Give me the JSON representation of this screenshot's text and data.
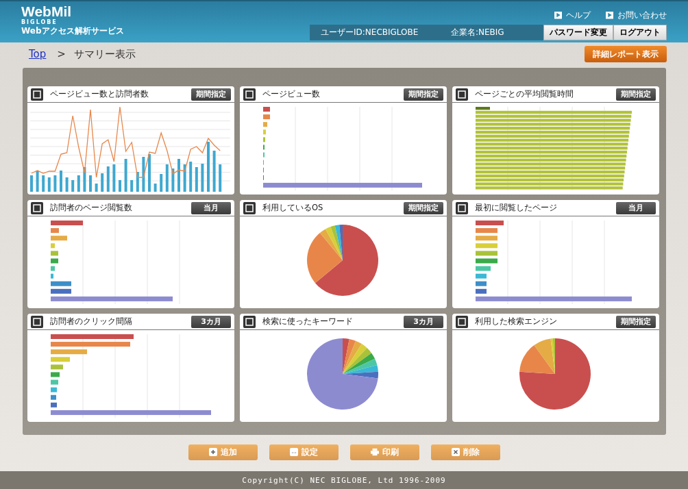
{
  "header": {
    "logo": "WebMil",
    "logo_sub1": "BIGLOBE",
    "logo_sub2": "Webアクセス解析サービス",
    "links": [
      "ヘルプ",
      "お問い合わせ"
    ],
    "user_id": "ユーザーID:NECBIGLOBE",
    "company": "企業名:NEBIG",
    "buttons": [
      "パスワード変更",
      "ログアウト"
    ]
  },
  "breadcrumb": {
    "link": "Top",
    "separator": ">",
    "current": "サマリー表示"
  },
  "report_button": "詳細レポート表示",
  "panels": [
    {
      "title": "ページビュー数と訪問者数",
      "period": "期間指定",
      "kind": "line-bar"
    },
    {
      "title": "ページビュー数",
      "period": "期間指定",
      "kind": "bar"
    },
    {
      "title": "ページごとの平均閲覧時間",
      "period": "期間指定",
      "kind": "bar"
    },
    {
      "title": "訪問者のページ閲覧数",
      "period": "当月",
      "kind": "bar"
    },
    {
      "title": "利用しているOS",
      "period": "期間指定",
      "kind": "pie"
    },
    {
      "title": "最初に閲覧したページ",
      "period": "当月",
      "kind": "bar"
    },
    {
      "title": "訪問者のクリック間隔",
      "period": "3カ月",
      "kind": "bar"
    },
    {
      "title": "検索に使ったキーワード",
      "period": "3カ月",
      "kind": "pie"
    },
    {
      "title": "利用した検索エンジン",
      "period": "期間指定",
      "kind": "pie"
    }
  ],
  "actions": [
    {
      "label": "追加",
      "kind": "add"
    },
    {
      "label": "設定",
      "kind": "settings"
    },
    {
      "label": "印刷",
      "kind": "print"
    },
    {
      "label": "削除",
      "kind": "delete"
    }
  ],
  "footer": "Copyright(C) NEC BIGLOBE, Ltd 1996-2009"
}
